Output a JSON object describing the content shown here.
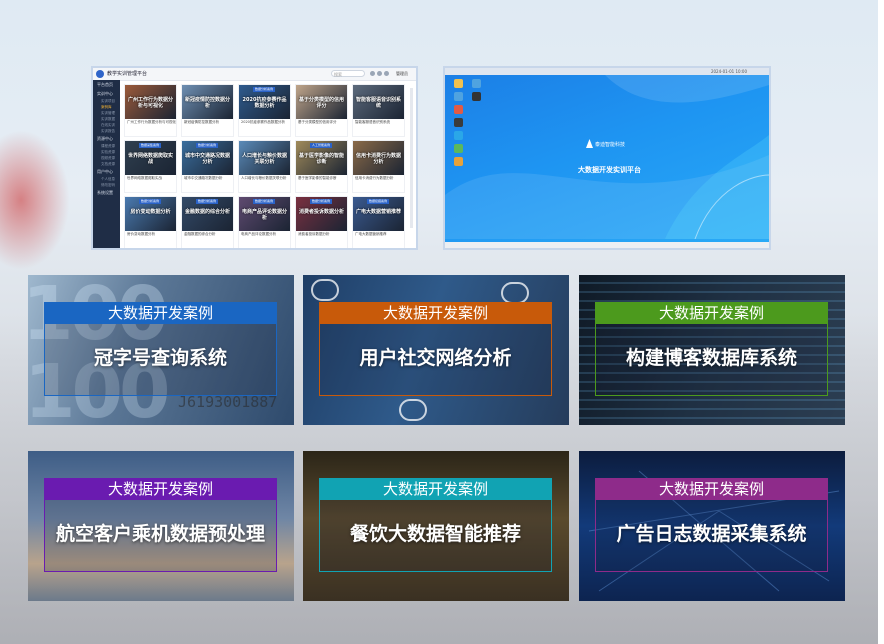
{
  "screenshot_platform": {
    "app_title": "教学实训管理平台",
    "search_placeholder": "搜索",
    "user": "管理员",
    "sidebar": [
      {
        "label": "平台首页",
        "subs": []
      },
      {
        "label": "实训中心",
        "subs": [
          "实训项目",
          "案例库",
          "实训管理",
          "实训数据",
          "在线实训",
          "实训报告"
        ]
      },
      {
        "label": "资源中心",
        "subs": [
          "课程资源",
          "实验资源",
          "视频资源",
          "文档资源"
        ]
      },
      {
        "label": "用户中心",
        "subs": [
          "个人信息",
          "修改密码"
        ]
      },
      {
        "label": "系统设置",
        "subs": []
      }
    ],
    "cards": [
      {
        "title": "广州工作行为数据分析与可视化",
        "caption": "广州工作行为数据分析与可视化",
        "tag": ""
      },
      {
        "title": "新冠疫情防控数据分析",
        "caption": "新冠疫情防控数据分析",
        "tag": ""
      },
      {
        "title": "2020抗疫参赛作品数据分析",
        "caption": "2020抗疫参赛作品数据分析",
        "tag": "数据分析案例"
      },
      {
        "title": "基于分类模型的信用评分",
        "caption": "基于分类模型的信用评分",
        "tag": ""
      },
      {
        "title": "智能客服语音识别系统",
        "caption": "智能客服语音识别系统",
        "tag": ""
      },
      {
        "title": "世界网络数据爬取实战",
        "caption": "世界网络数据爬取实战",
        "tag": "数据采集案例"
      },
      {
        "title": "城市中交通路况数据分析",
        "caption": "城市中交通路况数据分析",
        "tag": "数据分析案例"
      },
      {
        "title": "人口增长与粮价数据关联分析",
        "caption": "人口增长与粮价数据关联分析",
        "tag": ""
      },
      {
        "title": "基于医学影像的智能诊断",
        "caption": "基于医学影像的智能诊断",
        "tag": "人工智能案例"
      },
      {
        "title": "信用卡消费行为数据分析",
        "caption": "信用卡消费行为数据分析",
        "tag": ""
      },
      {
        "title": "房价变动数据分析",
        "caption": "房价变动数据分析",
        "tag": "数据分析案例"
      },
      {
        "title": "金融数据的综合分析",
        "caption": "金融数据的综合分析",
        "tag": "数据分析案例"
      },
      {
        "title": "电商产品评论数据分析",
        "caption": "电商产品评论数据分析",
        "tag": "数据分析案例"
      },
      {
        "title": "消费者投诉数据分析",
        "caption": "消费者投诉数据分析",
        "tag": "数据分析案例"
      },
      {
        "title": "广电大数据营销推荐",
        "caption": "广电大数据营销推荐",
        "tag": "数据挖掘案例"
      }
    ],
    "card_colors": [
      "#9b5a3a",
      "#6e8fb3",
      "#2e5b8e",
      "#c0a58a",
      "#5c6a7c",
      "#2f3f4f",
      "#3a6e9e",
      "#5a8ab8",
      "#a08a5a",
      "#8a6a48",
      "#4a7ab0",
      "#334a68",
      "#5f4a70",
      "#7a3040",
      "#3a5a90"
    ]
  },
  "screenshot_desktop": {
    "topbar_text": "2024-01-01 10:00",
    "brand": "泰迪智能科技",
    "platform_name": "大数据开发实训平台",
    "desktop_icon_colors": [
      "#f2c14e",
      "#4fa3e0",
      "#e25b45",
      "#3b3b3b",
      "#2aa7e8",
      "#5cb85c",
      "#e8a23a"
    ]
  },
  "case_tiles": [
    {
      "band": "大数据开发案例",
      "name": "冠字号查询系统",
      "color": "#1a66c2"
    },
    {
      "band": "大数据开发案例",
      "name": "用户社交网络分析",
      "color": "#c85a0a"
    },
    {
      "band": "大数据开发案例",
      "name": "构建博客数据库系统",
      "color": "#4c9a1d"
    },
    {
      "band": "大数据开发案例",
      "name": "航空客户乘机数据预处理",
      "color": "#6a1bb0"
    },
    {
      "band": "大数据开发案例",
      "name": "餐饮大数据智能推荐",
      "color": "#11a3b3"
    },
    {
      "band": "大数据开发案例",
      "name": "广告日志数据采集系统",
      "color": "#8e2b8a"
    }
  ],
  "tile1_deco": {
    "digits": "100",
    "serial": "J6193001887"
  }
}
